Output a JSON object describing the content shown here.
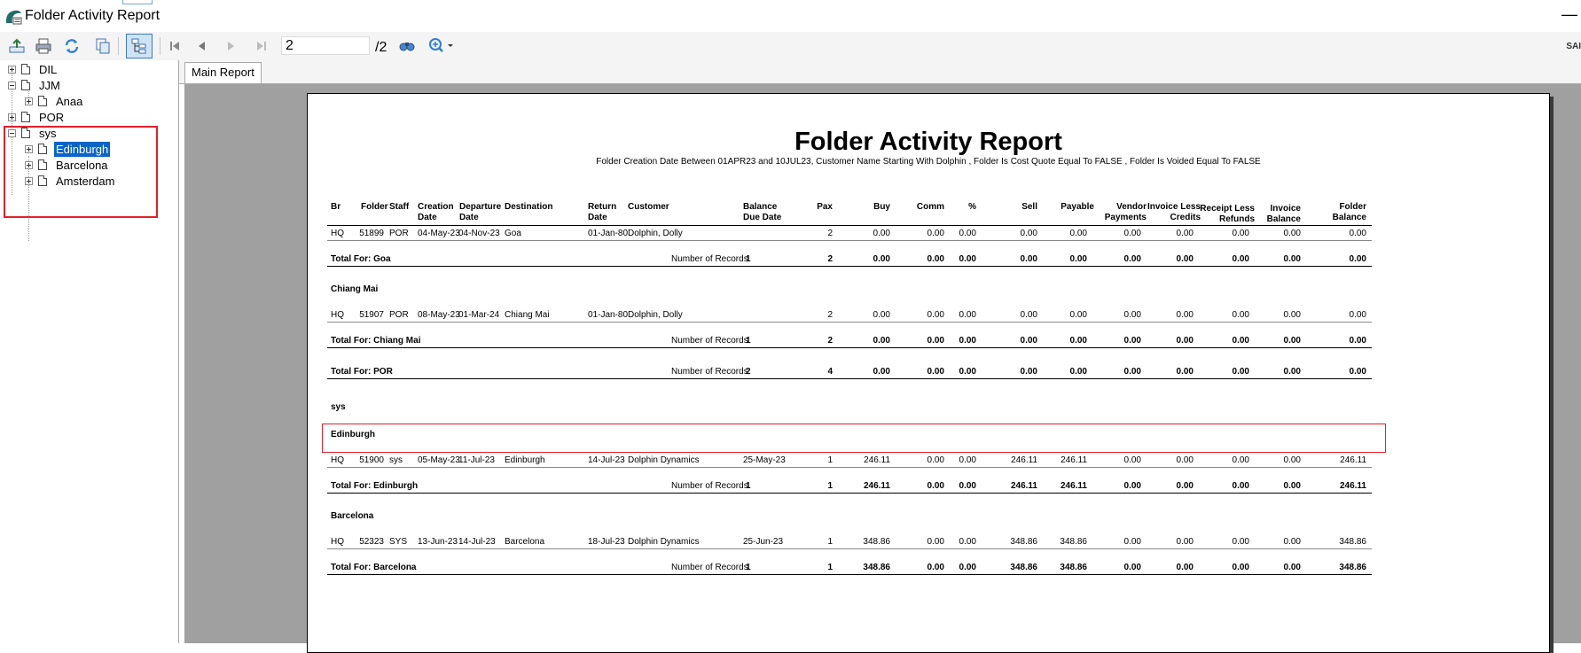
{
  "window": {
    "title": "Folder Activity Report",
    "minimize_glyph": "—",
    "brand_partial": "SAI"
  },
  "toolbar": {
    "buttons": [
      "export-icon",
      "print-icon",
      "refresh-icon",
      "copy-icon",
      "group-tree-icon",
      "first-page-icon",
      "prev-page-icon",
      "next-page-icon",
      "last-page-icon",
      "find-icon",
      "zoom-icon"
    ],
    "page_value": "2",
    "page_total": "/2"
  },
  "tree": {
    "items": [
      {
        "label": "DIL",
        "level": 0,
        "expander": "plus"
      },
      {
        "label": "JJM",
        "level": 0,
        "expander": "minus"
      },
      {
        "label": "Anaa",
        "level": 1,
        "expander": "plus"
      },
      {
        "label": "POR",
        "level": 0,
        "expander": "plus"
      },
      {
        "label": "sys",
        "level": 0,
        "expander": "minus"
      },
      {
        "label": "Edinburgh",
        "level": 1,
        "expander": "plus",
        "selected": true
      },
      {
        "label": "Barcelona",
        "level": 1,
        "expander": "plus"
      },
      {
        "label": "Amsterdam",
        "level": 1,
        "expander": "plus"
      }
    ]
  },
  "tabs": [
    {
      "label": "Main Report"
    }
  ],
  "report": {
    "title": "Folder Activity Report",
    "subtitle": "Folder Creation Date Between 01APR23 and 10JUL23, Customer Name Starting With Dolphin , Folder Is Cost Quote Equal To FALSE , Folder Is Voided Equal To FALSE",
    "headers": {
      "br": "Br",
      "folder": "Folder",
      "staff": "Staff",
      "creation1": "Creation",
      "creation2": "Date",
      "departure1": "Departure",
      "departure2": "Date",
      "destination": "Destination",
      "return1": "Return",
      "return2": "Date",
      "customer": "Customer",
      "balance1": "Balance",
      "balance2": "Due Date",
      "pax": "Pax",
      "buy": "Buy",
      "comm": "Comm",
      "pct": "%",
      "sell": "Sell",
      "payable": "Payable",
      "vendor1": "Vendor",
      "vendor2": "Payments",
      "invless1": "Invoice Less",
      "invless2": "Credits",
      "receipt1": "Receipt Less",
      "receipt2": "Refunds",
      "invbal1": "Invoice",
      "invbal2": "Balance",
      "folderbal1": "Folder",
      "folderbal2": "Balance"
    },
    "labels": {
      "num_records": "Number of Records"
    },
    "rows": {
      "goa": {
        "br": "HQ",
        "folder": "51899",
        "staff": "POR",
        "creation": "04-May-23",
        "departure": "04-Nov-23",
        "destination": "Goa",
        "return": "01-Jan-80",
        "customer": "Dolphin, Dolly",
        "balance_due": "",
        "pax": "2",
        "buy": "0.00",
        "comm": "0.00",
        "pct": "0.00",
        "sell": "0.00",
        "payable": "0.00",
        "vendor": "0.00",
        "invless": "0.00",
        "receipt": "0.00",
        "invbal": "0.00",
        "folderbal": "0.00"
      },
      "chiangmai": {
        "br": "HQ",
        "folder": "51907",
        "staff": "POR",
        "creation": "08-May-23",
        "departure": "01-Mar-24",
        "destination": "Chiang Mai",
        "return": "01-Jan-80",
        "customer": "Dolphin, Dolly",
        "balance_due": "",
        "pax": "2",
        "buy": "0.00",
        "comm": "0.00",
        "pct": "0.00",
        "sell": "0.00",
        "payable": "0.00",
        "vendor": "0.00",
        "invless": "0.00",
        "receipt": "0.00",
        "invbal": "0.00",
        "folderbal": "0.00"
      },
      "edinburgh": {
        "br": "HQ",
        "folder": "51900",
        "staff": "sys",
        "creation": "05-May-23",
        "departure": "11-Jul-23",
        "destination": "Edinburgh",
        "return": "14-Jul-23",
        "customer": "Dolphin Dynamics",
        "balance_due": "25-May-23",
        "pax": "1",
        "buy": "246.11",
        "comm": "0.00",
        "pct": "0.00",
        "sell": "246.11",
        "payable": "246.11",
        "vendor": "0.00",
        "invless": "0.00",
        "receipt": "0.00",
        "invbal": "0.00",
        "folderbal": "246.11"
      },
      "barcelona": {
        "br": "HQ",
        "folder": "52323",
        "staff": "SYS",
        "creation": "13-Jun-23",
        "departure": "14-Jul-23",
        "destination": "Barcelona",
        "return": "18-Jul-23",
        "customer": "Dolphin Dynamics",
        "balance_due": "25-Jun-23",
        "pax": "1",
        "buy": "348.86",
        "comm": "0.00",
        "pct": "0.00",
        "sell": "348.86",
        "payable": "348.86",
        "vendor": "0.00",
        "invless": "0.00",
        "receipt": "0.00",
        "invbal": "0.00",
        "folderbal": "348.86"
      }
    },
    "totals": {
      "goa": {
        "label": "Total For: Goa",
        "records": "1",
        "pax": "2",
        "buy": "0.00",
        "comm": "0.00",
        "pct": "0.00",
        "sell": "0.00",
        "payable": "0.00",
        "vendor": "0.00",
        "invless": "0.00",
        "receipt": "0.00",
        "invbal": "0.00",
        "folderbal": "0.00"
      },
      "chiangmai": {
        "label": "Total For: Chiang Mai",
        "records": "1",
        "pax": "2",
        "buy": "0.00",
        "comm": "0.00",
        "pct": "0.00",
        "sell": "0.00",
        "payable": "0.00",
        "vendor": "0.00",
        "invless": "0.00",
        "receipt": "0.00",
        "invbal": "0.00",
        "folderbal": "0.00"
      },
      "por": {
        "label": "Total For: POR",
        "records": "2",
        "pax": "4",
        "buy": "0.00",
        "comm": "0.00",
        "pct": "0.00",
        "sell": "0.00",
        "payable": "0.00",
        "vendor": "0.00",
        "invless": "0.00",
        "receipt": "0.00",
        "invbal": "0.00",
        "folderbal": "0.00"
      },
      "edinburgh": {
        "label": "Total For: Edinburgh",
        "records": "1",
        "pax": "1",
        "buy": "246.11",
        "comm": "0.00",
        "pct": "0.00",
        "sell": "246.11",
        "payable": "246.11",
        "vendor": "0.00",
        "invless": "0.00",
        "receipt": "0.00",
        "invbal": "0.00",
        "folderbal": "246.11"
      },
      "barcelona": {
        "label": "Total For: Barcelona",
        "records": "1",
        "pax": "1",
        "buy": "348.86",
        "comm": "0.00",
        "pct": "0.00",
        "sell": "348.86",
        "payable": "348.86",
        "vendor": "0.00",
        "invless": "0.00",
        "receipt": "0.00",
        "invbal": "0.00",
        "folderbal": "348.86"
      }
    },
    "groups": {
      "chiangmai": "Chiang Mai",
      "sys": "sys",
      "edinburgh": "Edinburgh",
      "barcelona": "Barcelona"
    }
  },
  "colors": {
    "selection": "#0a64c8",
    "highlight_border": "#e0202a",
    "canvas_gray": "#a0a0a0"
  }
}
